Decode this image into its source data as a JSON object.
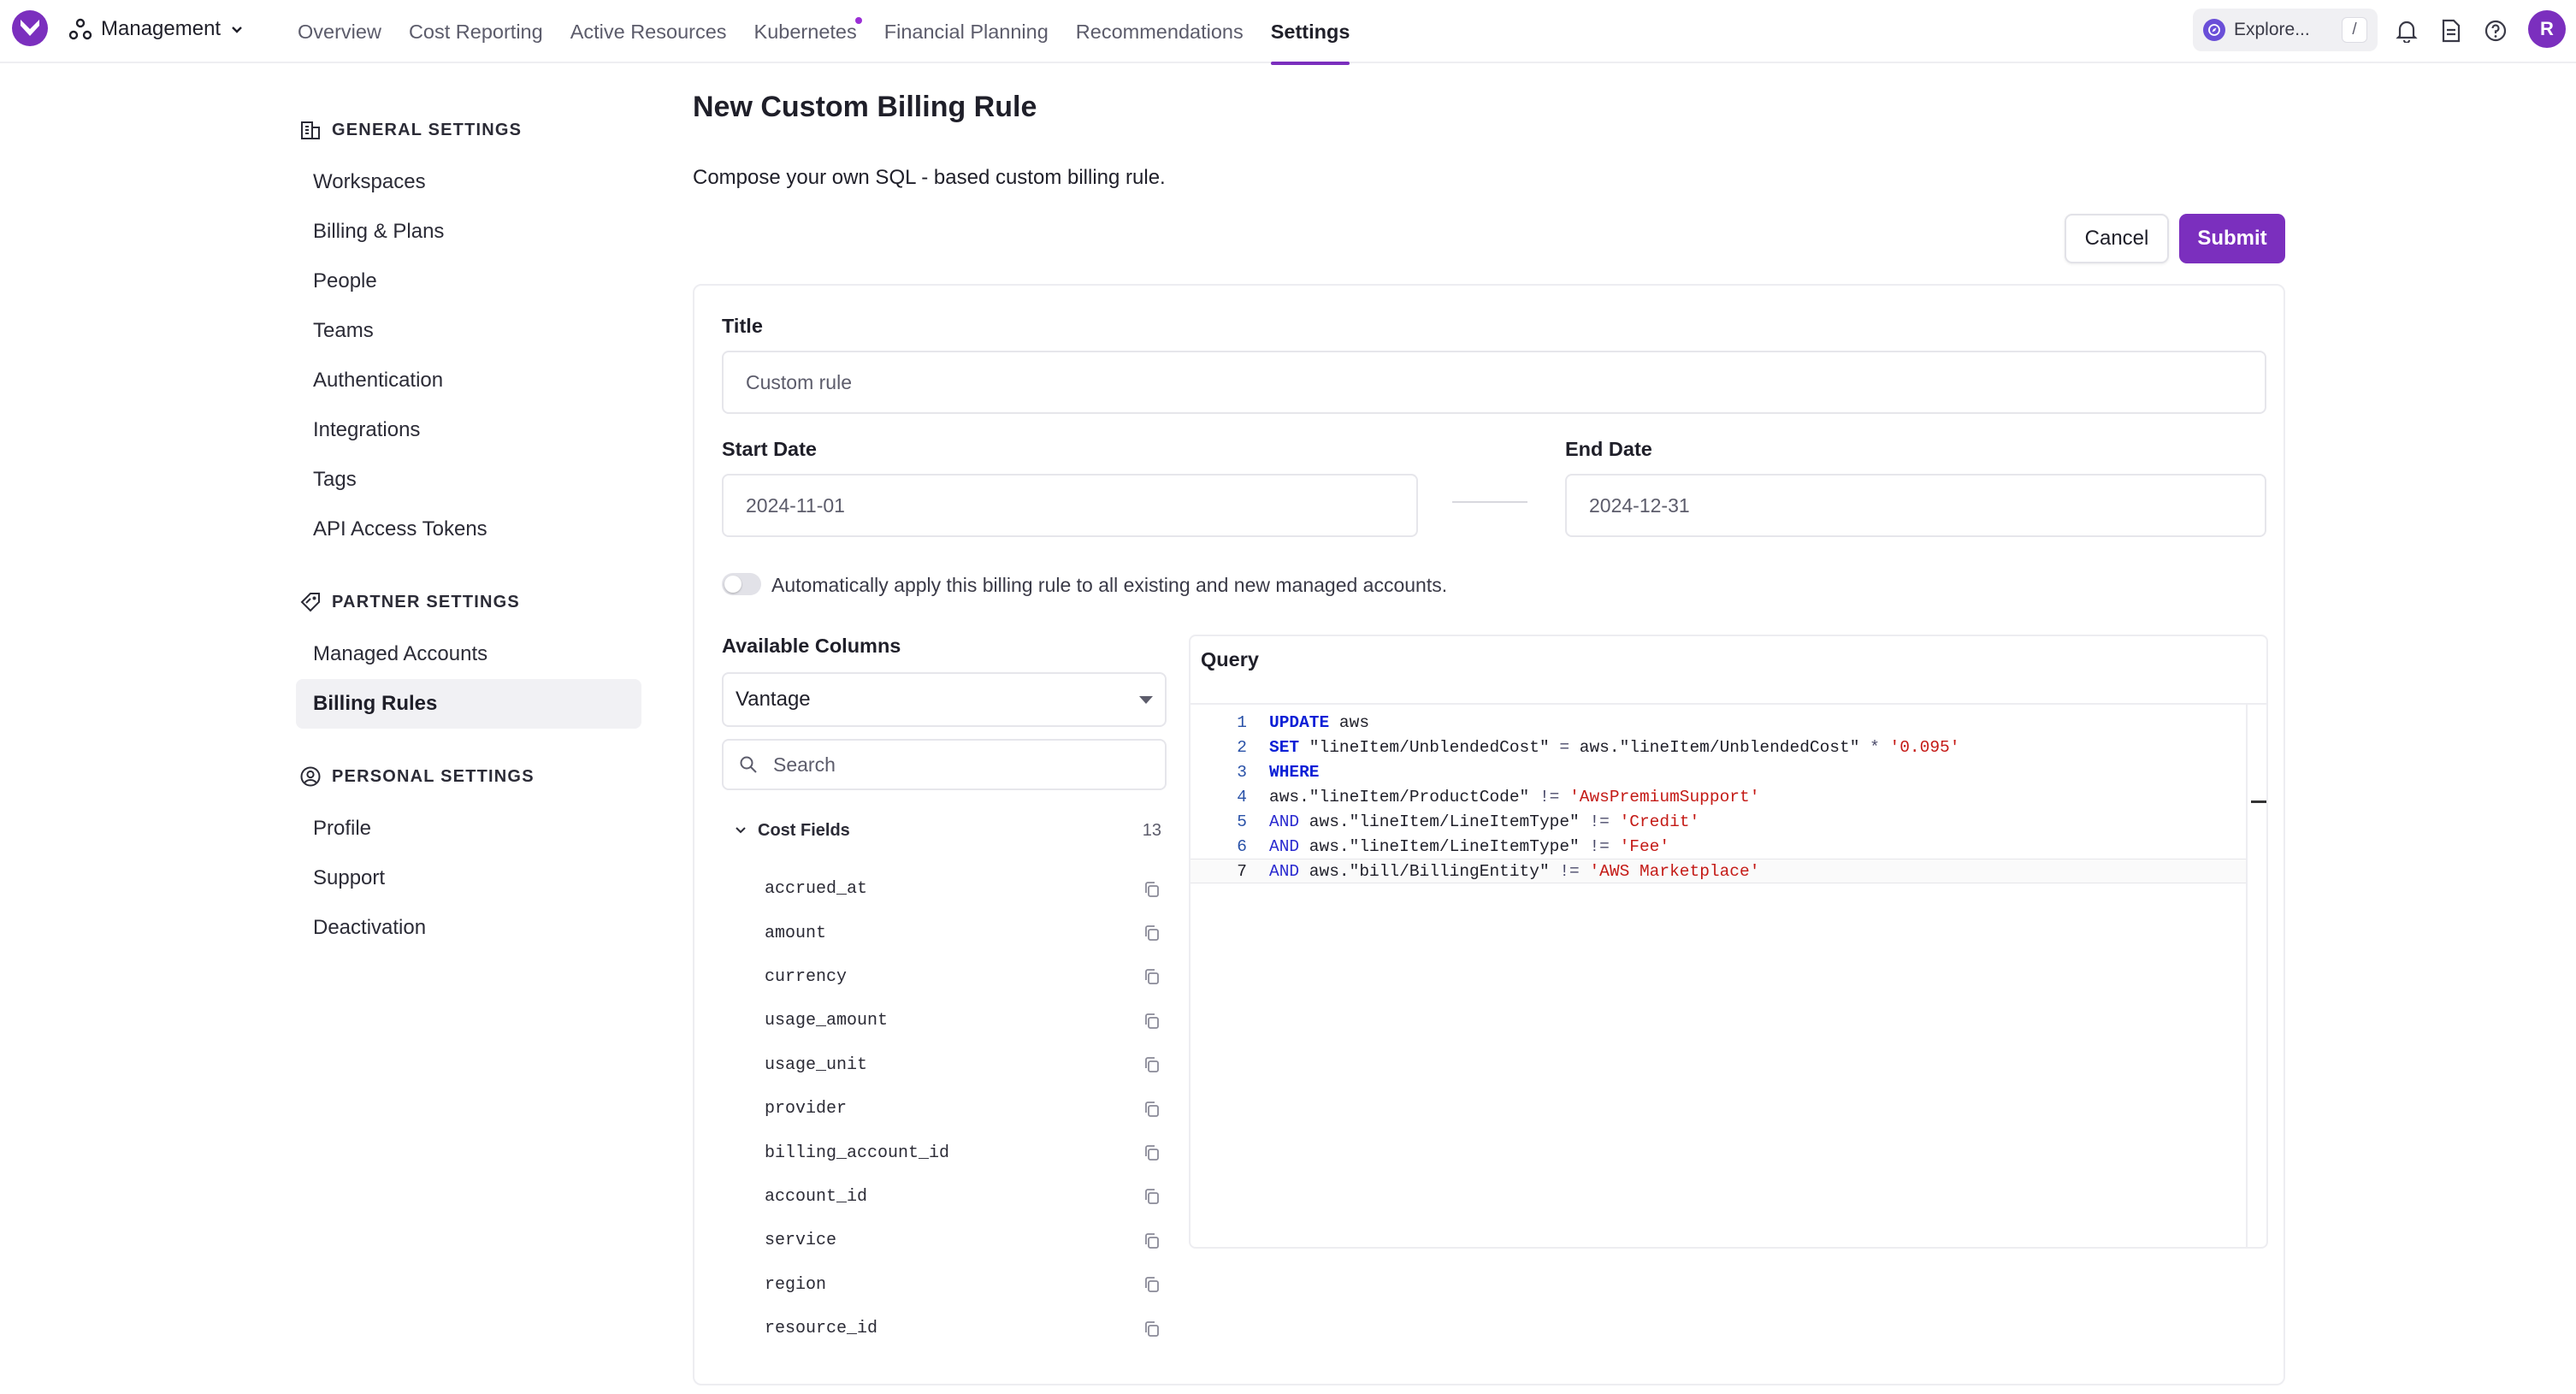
{
  "nav": {
    "org": "Management",
    "tabs": [
      {
        "label": "Overview",
        "active": false
      },
      {
        "label": "Cost Reporting",
        "active": false
      },
      {
        "label": "Active Resources",
        "active": false
      },
      {
        "label": "Kubernetes",
        "active": false,
        "dot": true
      },
      {
        "label": "Financial Planning",
        "active": false
      },
      {
        "label": "Recommendations",
        "active": false
      },
      {
        "label": "Settings",
        "active": true
      }
    ],
    "explore_label": "Explore...",
    "explore_shortcut": "/",
    "avatar_initial": "R",
    "accent": "#7b2fbe"
  },
  "sidebar": {
    "general_heading": "GENERAL SETTINGS",
    "general_items": [
      "Workspaces",
      "Billing & Plans",
      "People",
      "Teams",
      "Authentication",
      "Integrations",
      "Tags",
      "API Access Tokens"
    ],
    "partner_heading": "PARTNER SETTINGS",
    "partner_items": [
      "Managed Accounts",
      "Billing Rules"
    ],
    "partner_active": "Billing Rules",
    "personal_heading": "PERSONAL SETTINGS",
    "personal_items": [
      "Profile",
      "Support",
      "Deactivation"
    ]
  },
  "page": {
    "title": "New Custom Billing Rule",
    "subtitle": "Compose your own SQL - based custom billing rule.",
    "cancel_label": "Cancel",
    "submit_label": "Submit"
  },
  "form": {
    "title_label": "Title",
    "title_placeholder": "Custom rule",
    "start_label": "Start Date",
    "start_value": "2024-11-01",
    "end_label": "End Date",
    "end_value": "2024-12-31",
    "toggle_label": "Automatically apply this billing rule to all existing and new managed accounts.",
    "toggle_on": false
  },
  "columns": {
    "heading": "Available Columns",
    "source": "Vantage",
    "search_placeholder": "Search",
    "group_label": "Cost Fields",
    "group_count": "13",
    "fields": [
      "accrued_at",
      "amount",
      "currency",
      "usage_amount",
      "usage_unit",
      "provider",
      "billing_account_id",
      "account_id",
      "service",
      "region",
      "resource_id"
    ]
  },
  "query": {
    "heading": "Query",
    "lines": [
      [
        {
          "t": "kw",
          "v": "UPDATE"
        },
        {
          "t": "id",
          "v": " aws"
        }
      ],
      [
        {
          "t": "kw",
          "v": "SET"
        },
        {
          "t": "id",
          "v": " \"lineItem/UnblendedCost\" "
        },
        {
          "t": "op",
          "v": "="
        },
        {
          "t": "id",
          "v": " aws.\"lineItem/UnblendedCost\" "
        },
        {
          "t": "op",
          "v": "*"
        },
        {
          "t": "id",
          "v": " "
        },
        {
          "t": "str",
          "v": "'0.095'"
        }
      ],
      [
        {
          "t": "kw",
          "v": "WHERE"
        }
      ],
      [
        {
          "t": "id",
          "v": "aws.\"lineItem/ProductCode\" "
        },
        {
          "t": "op",
          "v": "!="
        },
        {
          "t": "id",
          "v": " "
        },
        {
          "t": "str",
          "v": "'AwsPremiumSupport'"
        }
      ],
      [
        {
          "t": "kw2",
          "v": "AND"
        },
        {
          "t": "id",
          "v": " aws.\"lineItem/LineItemType\" "
        },
        {
          "t": "op",
          "v": "!="
        },
        {
          "t": "id",
          "v": " "
        },
        {
          "t": "str",
          "v": "'Credit'"
        }
      ],
      [
        {
          "t": "kw2",
          "v": "AND"
        },
        {
          "t": "id",
          "v": " aws.\"lineItem/LineItemType\" "
        },
        {
          "t": "op",
          "v": "!="
        },
        {
          "t": "id",
          "v": " "
        },
        {
          "t": "str",
          "v": "'Fee'"
        }
      ],
      [
        {
          "t": "kw2",
          "v": "AND"
        },
        {
          "t": "id",
          "v": " aws.\"bill/BillingEntity\" "
        },
        {
          "t": "op",
          "v": "!="
        },
        {
          "t": "id",
          "v": " "
        },
        {
          "t": "str",
          "v": "'AWS Marketplace'"
        }
      ]
    ],
    "current_line": 7
  }
}
